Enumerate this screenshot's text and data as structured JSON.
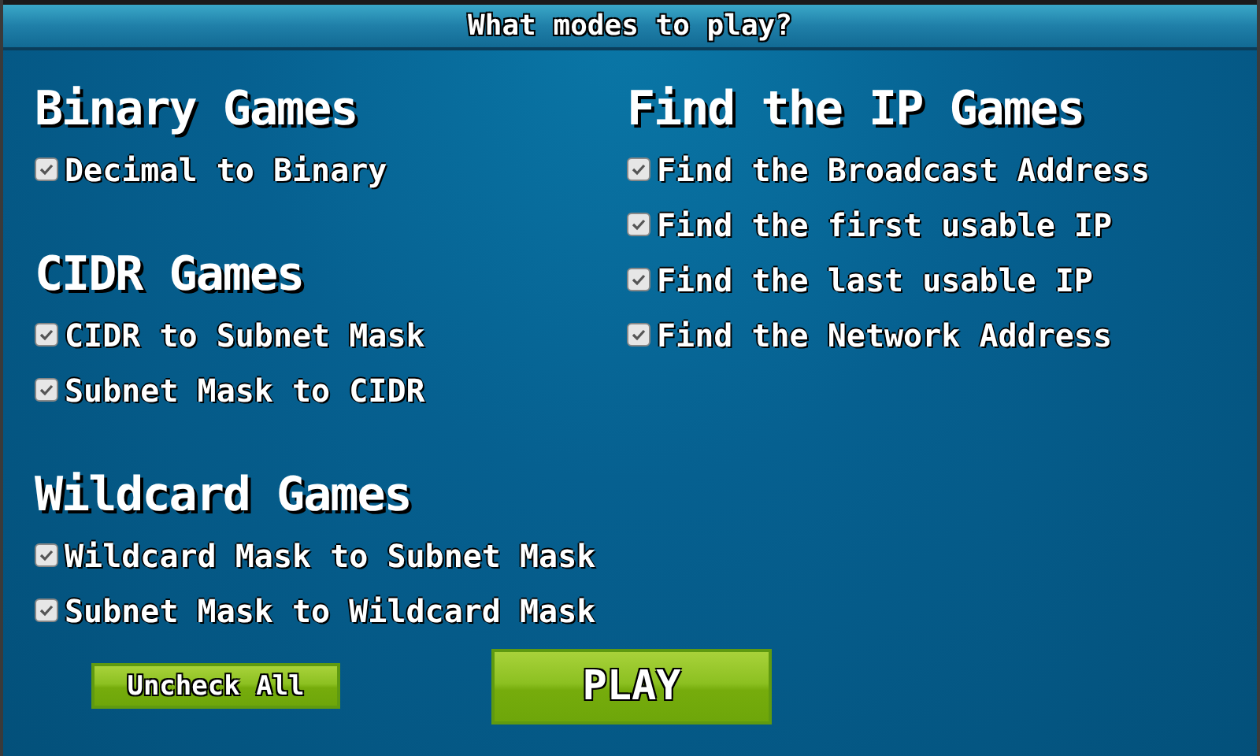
{
  "title": "What modes to play?",
  "columns": [
    {
      "groups": [
        {
          "heading": "Binary Games",
          "options": [
            {
              "label": "Decimal to Binary",
              "checked": true
            }
          ]
        },
        {
          "heading": "CIDR Games",
          "options": [
            {
              "label": "CIDR to Subnet Mask",
              "checked": true
            },
            {
              "label": "Subnet Mask to CIDR",
              "checked": true
            }
          ]
        },
        {
          "heading": "Wildcard Games",
          "options": [
            {
              "label": "Wildcard Mask to Subnet Mask",
              "checked": true
            },
            {
              "label": "Subnet Mask to Wildcard Mask",
              "checked": true
            }
          ]
        }
      ]
    },
    {
      "groups": [
        {
          "heading": "Find the IP Games",
          "options": [
            {
              "label": "Find the Broadcast Address",
              "checked": true
            },
            {
              "label": "Find the first usable IP",
              "checked": true
            },
            {
              "label": "Find the last usable IP",
              "checked": true
            },
            {
              "label": "Find the Network Address",
              "checked": true
            }
          ]
        }
      ]
    }
  ],
  "buttons": [
    {
      "label": "Uncheck All",
      "kind": "small"
    },
    {
      "label": "PLAY",
      "kind": "large"
    }
  ]
}
